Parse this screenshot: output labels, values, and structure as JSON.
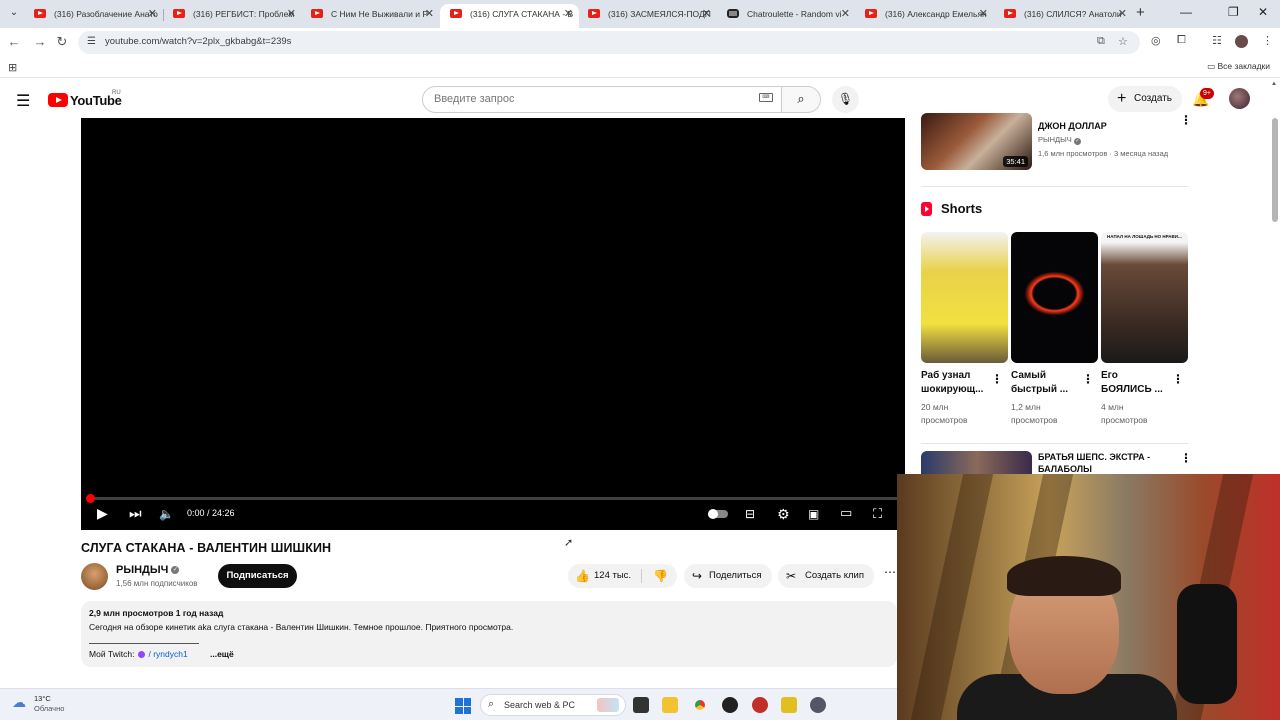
{
  "browser": {
    "tabs": [
      {
        "title": "(316) Разоблачение Анато",
        "icon": "youtube-icon"
      },
      {
        "title": "(316) РЕГБИСТ: Проблем",
        "icon": "youtube-icon"
      },
      {
        "title": "С Ним Не Выживали и Р",
        "icon": "youtube-icon"
      },
      {
        "title": "(316) СЛУГА СТАКАНА - В",
        "icon": "youtube-icon",
        "active": true
      },
      {
        "title": "(316) ЗАСМЕЯЛСЯ-ПОДП",
        "icon": "youtube-icon"
      },
      {
        "title": "Chatroulette - Random vi",
        "icon": "chatroulette-icon"
      },
      {
        "title": "(316) Александр Емельян",
        "icon": "youtube-icon"
      },
      {
        "title": "(316) СЛИЛСЯ? Анатоли",
        "icon": "youtube-icon"
      }
    ],
    "url": "youtube.com/watch?v=2plx_gkbabg&t=239s",
    "all_bookmarks": "Все закладки"
  },
  "youtube": {
    "logo_text": "YouTube",
    "region": "RU",
    "search_placeholder": "Введите запрос",
    "create_label": "Создать",
    "notifications_badge": "9+"
  },
  "player": {
    "time": "0:00 / 24:26",
    "progress_fraction": 0.0
  },
  "video": {
    "title": "СЛУГА СТАКАНА - ВАЛЕНТИН ШИШКИН",
    "channel": "РЫНДЫЧ",
    "subscribers": "1,56 млн подписчиков",
    "subscribe_label": "Подписаться",
    "likes": "124 тыс.",
    "share_label": "Поделиться",
    "clip_label": "Создать клип",
    "views_date": "2,9 млн просмотров  1 год назад",
    "description": "Сегодня на обзоре кинетик aka слуга стакана - Валентин Шишкин. Темное прошлое. Приятного просмотра.",
    "twitch_label": "Мой Twitch:",
    "twitch_link": "/ ryndych1",
    "more_label": "...ещё"
  },
  "sidebar": {
    "top_video": {
      "title": "ДЖОН ДОЛЛАР",
      "channel": "РЫНДЫЧ",
      "meta": "1,6 млн просмотров · 3 месяца назад",
      "duration": "35:41"
    },
    "shorts_heading": "Shorts",
    "shorts": [
      {
        "title": "Раб узнал шокирующ...",
        "views": "20 млн просмотров"
      },
      {
        "title": "Самый быстрый ...",
        "views": "1,2 млн просмотров"
      },
      {
        "title": "Его БОЯЛИСЬ ...",
        "views": "4 млн просмотров"
      }
    ],
    "short3_caption": "НАПАЛ НА ЛОШАДЬ НО НРАВИ...",
    "next_video": {
      "title": "БРАТЬЯ ШЕПС. ЭКСТРА - БАЛАБОЛЫ"
    }
  },
  "taskbar": {
    "temperature": "13°C",
    "weather": "Облачно",
    "search_text": "Search web & PC"
  }
}
